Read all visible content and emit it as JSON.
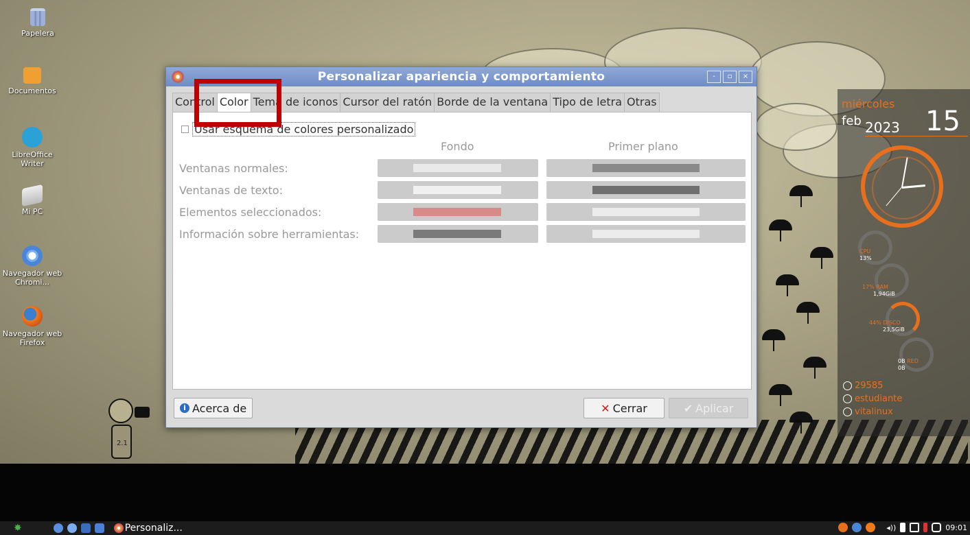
{
  "desktop": {
    "icons": [
      {
        "label": "Papelera",
        "icon": "trash-icon"
      },
      {
        "label": "Documentos",
        "icon": "folder-icon"
      },
      {
        "label": "LibreOffice Writer",
        "icon": "writer-icon"
      },
      {
        "label": "Mi PC",
        "icon": "computer-icon"
      },
      {
        "label": "Navegador web Chromi...",
        "icon": "chromium-icon"
      },
      {
        "label": "Navegador web Firefox",
        "icon": "firefox-icon"
      }
    ],
    "wallpaper_label": "2.1"
  },
  "dialog": {
    "title": "Personalizar apariencia y comportamiento",
    "window_buttons": {
      "minimize": "-",
      "maximize": "▫",
      "close": "×"
    },
    "tabs": [
      "Control",
      "Color",
      "Tema de iconos",
      "Cursor del ratón",
      "Borde de la ventana",
      "Tipo de letra",
      "Otras"
    ],
    "active_tab": "Color",
    "checkbox_label": "Usar esquema de colores personalizado",
    "checkbox_checked": false,
    "columns": {
      "background": "Fondo",
      "foreground": "Primer plano"
    },
    "rows": [
      {
        "label": "Ventanas normales:",
        "bg_color": "#e9e9e9",
        "fg_color": "#8a8a8a"
      },
      {
        "label": "Ventanas de texto:",
        "bg_color": "#f0f0f0",
        "fg_color": "#707070"
      },
      {
        "label": "Elementos seleccionados:",
        "bg_color": "#d88a88",
        "fg_color": "#ececec"
      },
      {
        "label": "Información sobre herramientas:",
        "bg_color": "#7a7a7a",
        "fg_color": "#ececec"
      }
    ],
    "buttons": {
      "about": "Acerca de",
      "close": "Cerrar",
      "apply": "Aplicar"
    }
  },
  "annotation": {
    "color": "#c00000"
  },
  "conky": {
    "weekday": "miércoles",
    "month": "feb",
    "year": "2023",
    "day": "15",
    "cpu": {
      "label": "CPU",
      "value": "13%"
    },
    "ram": {
      "label": "17% RAM",
      "value": "1,94GiB"
    },
    "disk": {
      "label": "44% DISCO",
      "value": "23,5GiB"
    },
    "net": {
      "up": "0B",
      "label": "RED",
      "down": "0B"
    },
    "uptime": "29585",
    "user": "estudiante",
    "host": "vitalinux",
    "accent": "#e8701d"
  },
  "taskbar": {
    "window_label": "Personaliz...",
    "clock": "09:01"
  }
}
